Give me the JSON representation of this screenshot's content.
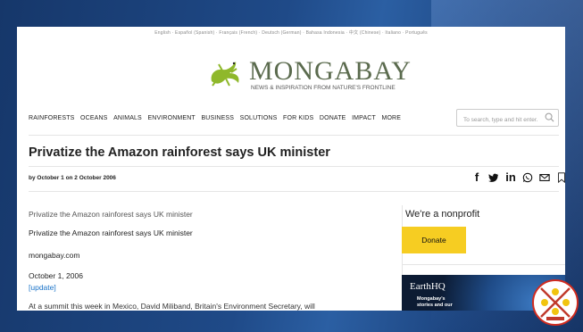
{
  "language_bar": "English · Español (Spanish) · Français (French) · Deutsch (German) · Bahasa Indonesia · 中文 (Chinese) · Italiano · Português",
  "brand": {
    "name": "MONGABAY",
    "tagline": "NEWS & INSPIRATION FROM NATURE'S FRONTLINE"
  },
  "nav": {
    "items": [
      "RAINFORESTS",
      "OCEANS",
      "ANIMALS",
      "ENVIRONMENT",
      "BUSINESS",
      "SOLUTIONS",
      "FOR KIDS",
      "DONATE",
      "IMPACT",
      "MORE"
    ]
  },
  "search": {
    "placeholder": "To search, type and hit enter."
  },
  "article": {
    "headline": "Privatize the Amazon rainforest says UK minister",
    "byline_prefix": "by",
    "byline_author": "October 1",
    "byline_suffix": "on 2 October 2006",
    "paragraphs": {
      "summary": "Privatize the Amazon rainforest says UK minister",
      "title_repeat": "Privatize the Amazon rainforest says UK minister",
      "source": "mongabay.com",
      "date": "October 1, 2006",
      "update": "[update]",
      "lead": "At a summit this week in Mexico, David Miliband, Britain's Environment Secretary, will"
    }
  },
  "share_icons": [
    "facebook-icon",
    "twitter-icon",
    "linkedin-icon",
    "whatsapp-icon",
    "email-icon",
    "bookmark-icon"
  ],
  "sidebar": {
    "nonprofit_title": "We're a nonprofit",
    "donate_label": "Donate",
    "promo": {
      "title": "EarthHQ",
      "line1": "Mongabay's",
      "line2": "stories and our"
    }
  },
  "colors": {
    "accent_donate": "#f6cd22",
    "link": "#1a73c8",
    "brand_green": "#5b6b4e"
  }
}
